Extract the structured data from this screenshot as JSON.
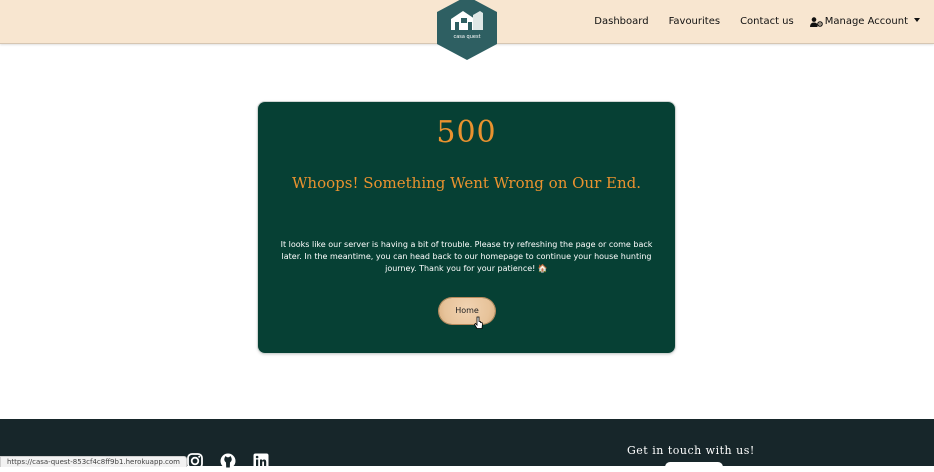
{
  "logo": {
    "text": "casa quest",
    "bg_color": "#2e5f62"
  },
  "nav": {
    "dashboard": "Dashboard",
    "favourites": "Favourites",
    "contact": "Contact us",
    "manage_account": "Manage Account"
  },
  "error": {
    "code": "500",
    "title": "Whoops! Something Went Wrong on Our End.",
    "message": "It looks like our server is having a bit of trouble. Please try refreshing the page or come back later. In the meantime, you can head back to our homepage to continue your house hunting journey. Thank you for your patience! 🏠",
    "home_button": "Home"
  },
  "footer": {
    "heading": "Get in touch with us!",
    "socials": [
      "instagram-icon",
      "github-icon",
      "linkedin-icon"
    ]
  },
  "status_bar": {
    "url": "https://casa-quest-853cf4c8ff9b1.herokuapp.com"
  },
  "colors": {
    "navbar_bg": "#f8e6d0",
    "card_bg": "#064034",
    "accent": "#e9922f",
    "footer_bg": "#17262a"
  }
}
